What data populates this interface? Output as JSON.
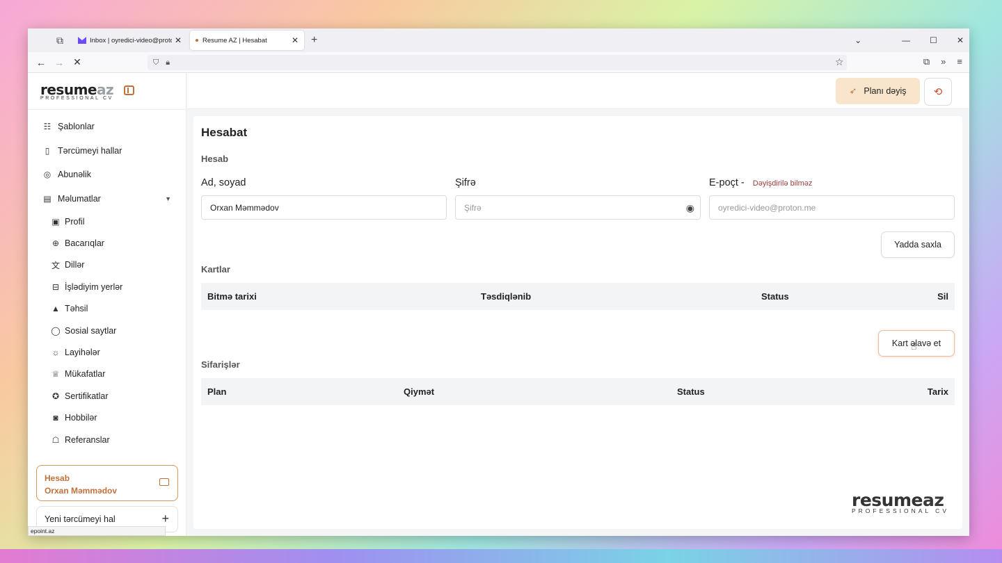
{
  "browser": {
    "tabs": [
      {
        "label": "Inbox | oyredici-video@proton.me",
        "active": false
      },
      {
        "label": "Resume AZ | Hesabat",
        "active": true
      }
    ],
    "status_url": "epoint.az"
  },
  "sidebar": {
    "logo_main": "resume",
    "logo_az": "az",
    "logo_sub": "PROFESSIONAL CV",
    "items": [
      {
        "label": "Şablonlar",
        "icon": "template-icon"
      },
      {
        "label": "Tərcümeyi hallar",
        "icon": "clipboard-icon"
      },
      {
        "label": "Abunəlik",
        "icon": "check-circle-icon"
      },
      {
        "label": "Məlumatlar",
        "icon": "data-icon"
      }
    ],
    "subitems": [
      {
        "label": "Profil",
        "icon": "id-card-icon"
      },
      {
        "label": "Bacarıqlar",
        "icon": "brain-icon"
      },
      {
        "label": "Dillər",
        "icon": "translate-icon"
      },
      {
        "label": "İşlədiyim yerlər",
        "icon": "briefcase-icon"
      },
      {
        "label": "Təhsil",
        "icon": "graduation-cap-icon"
      },
      {
        "label": "Sosial saytlar",
        "icon": "chat-icon"
      },
      {
        "label": "Layihələr",
        "icon": "lightbulb-icon"
      },
      {
        "label": "Mükafatlar",
        "icon": "trophy-icon"
      },
      {
        "label": "Sertifikatlar",
        "icon": "award-icon"
      },
      {
        "label": "Hobbilər",
        "icon": "camera-icon"
      },
      {
        "label": "Referanslar",
        "icon": "reference-icon"
      }
    ],
    "account": {
      "title": "Hesab",
      "name": "Orxan Məmmədov"
    },
    "new_cv": "Yeni tərcümeyi hal"
  },
  "topbar": {
    "plan_button": "Planı dəyiş"
  },
  "main": {
    "title": "Hesabat",
    "account_section": "Hesab",
    "fields": {
      "name_label": "Ad, soyad",
      "name_value": "Orxan Məmmədov",
      "password_label": "Şifrə",
      "password_placeholder": "Şifrə",
      "email_label": "E-poçt -",
      "email_note": "Dəyişdirilə bilməz",
      "email_value": "oyredici-video@proton.me"
    },
    "save_button": "Yadda saxla",
    "cards_section": "Kartlar",
    "cards_columns": [
      "Bitmə tarixi",
      "Təsdiqlənib",
      "Status",
      "Sil"
    ],
    "add_card_button": "Kart əlavə et",
    "orders_section": "Sifarişlər",
    "orders_columns": [
      "Plan",
      "Qiymət",
      "Status",
      "Tarix"
    ],
    "watermark_main": "resume",
    "watermark_az": "az",
    "watermark_sub": "PROFESSIONAL CV"
  },
  "colors": {
    "accent": "#c0703a",
    "plan_bg": "#f9e4cc",
    "logout": "#d14a2a",
    "note": "#9a3b3b"
  }
}
